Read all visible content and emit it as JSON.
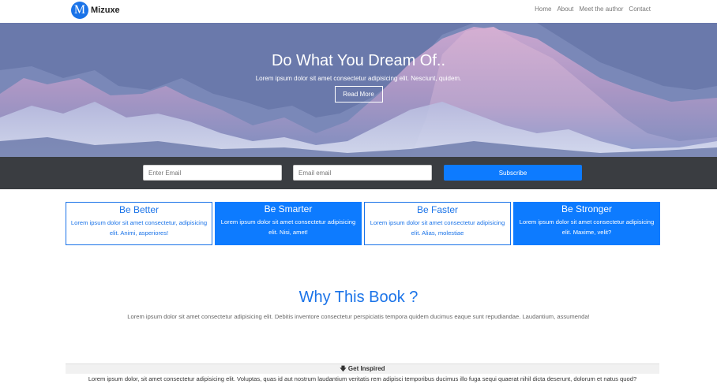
{
  "navbar": {
    "brand_letter": "M",
    "brand_name": "Mizuxe",
    "links": [
      "Home",
      "About",
      "Meet the author",
      "Contact"
    ]
  },
  "hero": {
    "title": "Do What You Dream Of..",
    "subtitle": "Lorem ipsum dolor sit amet consectetur adipisicing elit. Nesciunt, quidem.",
    "button_label": "Read More"
  },
  "subscribe": {
    "name_placeholder": "Enter Email",
    "email_placeholder": "Email email",
    "button_label": "Subscribe"
  },
  "cards": [
    {
      "title": "Be Better",
      "text": "Lorem ipsum dolor sit amet consectetur, adipisicing elit. Animi, asperiores!",
      "style": "outline"
    },
    {
      "title": "Be Smarter",
      "text": "Lorem ipsum dolor sit amet consectetur adipisicing elit. Nisi, amet!",
      "style": "filled"
    },
    {
      "title": "Be Faster",
      "text": "Lorem ipsum dolor sit amet consectetur adipisicing elit. Alias, molestiae",
      "style": "outline"
    },
    {
      "title": "Be Stronger",
      "text": "Lorem ipsum dolor sit amet consectetur adipisicing elit. Maxime, velit?",
      "style": "filled"
    }
  ],
  "why": {
    "title": "Why This Book ?",
    "text": "Lorem ipsum dolor sit amet consectetur adipisicing elit. Debitis inventore consectetur perspiciatis tempora quidem ducimus eaque sunt repudiandae. Laudantium, assumenda!"
  },
  "accordion": {
    "header_icon": "arrow-down-icon",
    "header_label": "Get Inspired",
    "body": "Lorem ipsum dolor, sit amet consectetur adipisicing elit. Voluptas, quas id aut nostrum laudantium veritatis rem adipisci temporibus ducimus illo fuga sequi quaerat nihil dicta deserunt, dolorum et natus quod?"
  },
  "colors": {
    "primary": "#0d7bff",
    "brand_blue": "#1a73e8",
    "dark_bar": "#3a3d41"
  }
}
